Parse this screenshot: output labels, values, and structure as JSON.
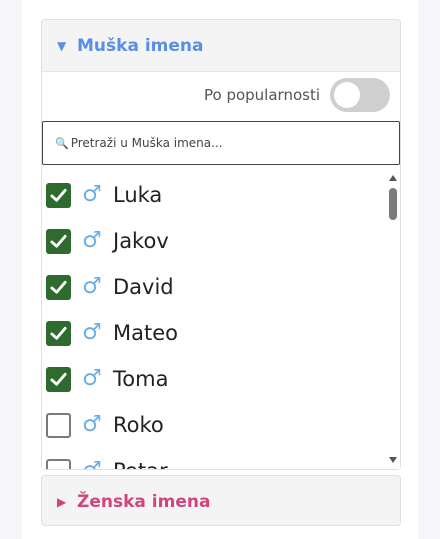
{
  "men_section": {
    "title": "Muška imena",
    "arrow": "▼",
    "sort_label": "Po popularnosti",
    "sort_enabled": false,
    "search_placeholder": "Pretraži u Muška imena...",
    "search_icon": "🔍",
    "gender_symbol": "♂",
    "names": [
      {
        "label": "Luka",
        "checked": true
      },
      {
        "label": "Jakov",
        "checked": true
      },
      {
        "label": "David",
        "checked": true
      },
      {
        "label": "Mateo",
        "checked": true
      },
      {
        "label": "Toma",
        "checked": true
      },
      {
        "label": "Roko",
        "checked": false
      },
      {
        "label": "Petar",
        "checked": false
      }
    ]
  },
  "women_section": {
    "title": "Ženska imena",
    "arrow": "▶"
  },
  "colors": {
    "men_accent": "#5b8fe6",
    "women_accent": "#d1447e",
    "checkbox_checked": "#2f6b2f",
    "male_symbol": "#6aaee6"
  }
}
